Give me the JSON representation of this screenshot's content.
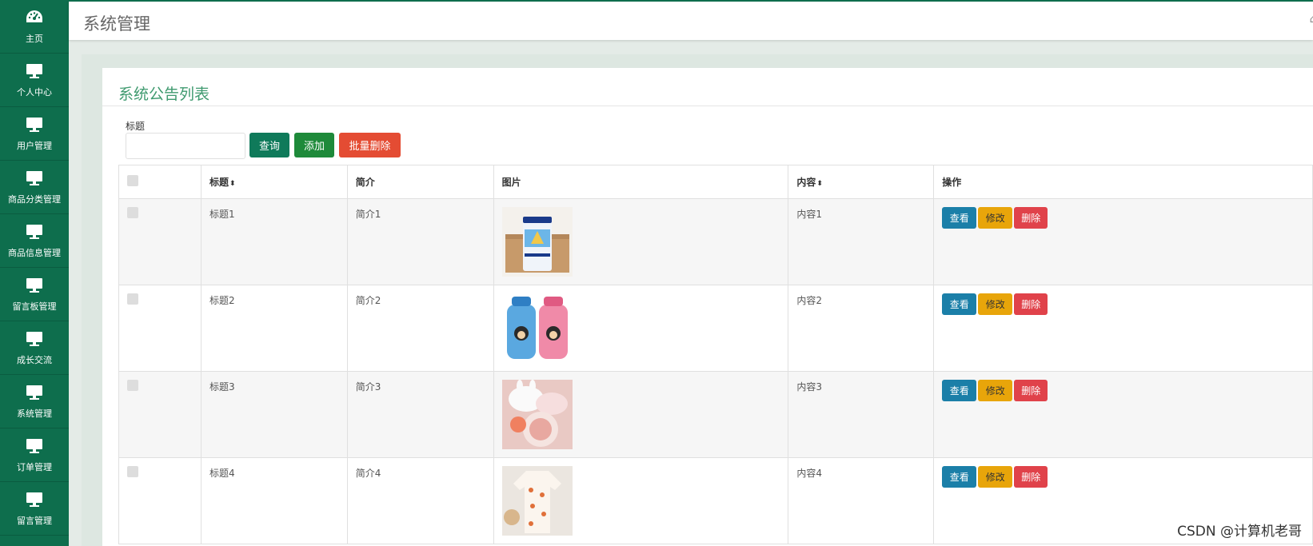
{
  "sidebar": {
    "items": [
      {
        "label": "主页",
        "icon": "dashboard-icon"
      },
      {
        "label": "个人中心",
        "icon": "monitor-icon"
      },
      {
        "label": "用户管理",
        "icon": "monitor-icon"
      },
      {
        "label": "商品分类管理",
        "icon": "monitor-icon"
      },
      {
        "label": "商品信息管理",
        "icon": "monitor-icon"
      },
      {
        "label": "留言板管理",
        "icon": "monitor-icon"
      },
      {
        "label": "成长交流",
        "icon": "monitor-icon"
      },
      {
        "label": "系统管理",
        "icon": "monitor-icon"
      },
      {
        "label": "订单管理",
        "icon": "monitor-icon"
      },
      {
        "label": "留言管理",
        "icon": "monitor-icon"
      }
    ]
  },
  "header": {
    "title": "系统管理"
  },
  "panel": {
    "title": "系统公告列表",
    "search": {
      "label": "标题",
      "value": "",
      "placeholder": ""
    },
    "buttons": {
      "query": "查询",
      "add": "添加",
      "batch_delete": "批量删除"
    }
  },
  "table": {
    "headers": {
      "title": "标题",
      "intro": "简介",
      "image": "图片",
      "content": "内容",
      "actions": "操作"
    },
    "rows": [
      {
        "title": "标题1",
        "intro": "简介1",
        "content": "内容1",
        "image": "formula-can-image"
      },
      {
        "title": "标题2",
        "intro": "简介2",
        "content": "内容2",
        "image": "baby-bottles-image"
      },
      {
        "title": "标题3",
        "intro": "简介3",
        "content": "内容3",
        "image": "tableware-image"
      },
      {
        "title": "标题4",
        "intro": "简介4",
        "content": "内容4",
        "image": "baby-clothes-image"
      }
    ],
    "actions": {
      "view": "查看",
      "edit": "修改",
      "delete": "删除"
    }
  },
  "watermark": "CSDN @计算机老哥",
  "colors": {
    "sidebar": "#0e6e4d",
    "accent": "#3f9a6f",
    "view": "#1b7fa8",
    "edit": "#e8a50a",
    "delete": "#e0424a"
  }
}
